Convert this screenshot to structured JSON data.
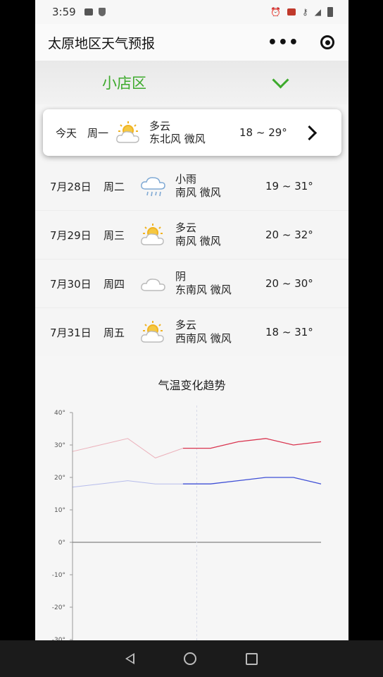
{
  "status": {
    "time": "3:59"
  },
  "nav": {
    "title": "太原地区天气预报"
  },
  "district": {
    "name": "小店区"
  },
  "today": {
    "day": "今天",
    "weekday": "周一",
    "icon": "partly-cloudy-icon",
    "weather": "多云",
    "wind": "东北风 微风",
    "temp": "18 ~ 29°"
  },
  "forecast": [
    {
      "date": "7月28日",
      "weekday": "周二",
      "icon": "rain-icon",
      "weather": "小雨",
      "wind": "南风 微风",
      "temp": "19 ~ 31°"
    },
    {
      "date": "7月29日",
      "weekday": "周三",
      "icon": "partly-cloudy-icon",
      "weather": "多云",
      "wind": "南风 微风",
      "temp": "20 ~ 32°"
    },
    {
      "date": "7月30日",
      "weekday": "周四",
      "icon": "overcast-icon",
      "weather": "阴",
      "wind": "东南风 微风",
      "temp": "20 ~ 30°"
    },
    {
      "date": "7月31日",
      "weekday": "周五",
      "icon": "partly-cloudy-icon",
      "weather": "多云",
      "wind": "西南风 微风",
      "temp": "18 ~ 31°"
    }
  ],
  "chart_data": {
    "type": "line",
    "title": "气温变化趋势",
    "ylim": [
      -30,
      40
    ],
    "yticks": [
      "40°",
      "30°",
      "20°",
      "10°",
      "0°",
      "-10°",
      "-20°",
      "-30°"
    ],
    "yticks_values": [
      40,
      30,
      20,
      10,
      0,
      -10,
      -20,
      -30
    ],
    "x": [
      0,
      1,
      2,
      3,
      4,
      5,
      6,
      7,
      8
    ],
    "series": [
      {
        "key": "high",
        "values": [
          28,
          30,
          32,
          26,
          29,
          29,
          31,
          32,
          30,
          31
        ],
        "color": "#d9344f"
      },
      {
        "key": "low",
        "values": [
          17,
          18,
          19,
          18,
          18,
          18,
          19,
          20,
          20,
          18
        ],
        "color": "#3f4fd6"
      }
    ],
    "split_index": 4.5,
    "grid": false
  }
}
